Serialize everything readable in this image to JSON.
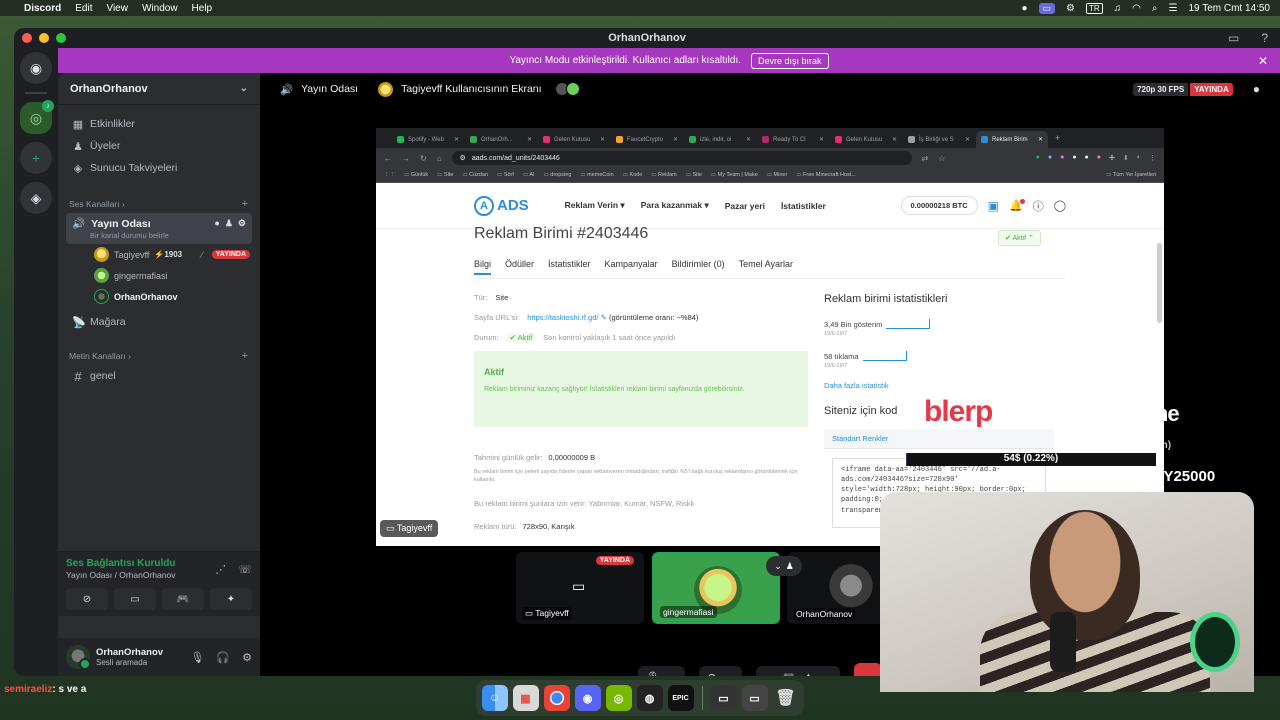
{
  "menubar": {
    "app": "Discord",
    "items": [
      "Edit",
      "View",
      "Window",
      "Help"
    ],
    "keyboard": "TR",
    "datetime": "19 Tem Cmt  14:50"
  },
  "window": {
    "title": "OrhanOrhanov"
  },
  "banner": {
    "text": "Yayıncı Modu etkinleştirildi. Kullanıcı adları kısaltıldı.",
    "button": "Devre dışı bırak"
  },
  "sidebar": {
    "server_name": "OrhanOrhanov",
    "nav": [
      {
        "icon": "calendar-icon",
        "label": "Etkinlikler"
      },
      {
        "icon": "members-icon",
        "label": "Üyeler"
      },
      {
        "icon": "boost-icon",
        "label": "Sunucu Takviyeleri"
      }
    ],
    "voice_category": "Ses Kanalları",
    "voice_channel": {
      "name": "Yayın Odası",
      "status": "Bir kanal durumu belirle"
    },
    "voice_users": [
      {
        "name": "Tagiyevff",
        "boost": "1903",
        "live": "YAYINDA"
      },
      {
        "name": "gingermafiasi"
      },
      {
        "name": "OrhanOrhanov"
      }
    ],
    "stage_channel": "Mağara",
    "text_category": "Metin Kanalları",
    "text_channel": "genel"
  },
  "voice_panel": {
    "title": "Ses Bağlantısı Kuruldu",
    "subtitle": "Yayın Odası / OrhanOrhanov"
  },
  "user_panel": {
    "name": "OrhanOrhanov",
    "status": "Sesli aramada"
  },
  "stage": {
    "channel": "Yayın Odası",
    "screen_title": "Tagiyevff Kullanıcısının Ekranı",
    "quality": "720p 30 FPS",
    "live": "YAYINDA",
    "owner_label": "Tagiyevff"
  },
  "browser": {
    "tabs": [
      "Spotify - Web",
      "OrhanOrh...",
      "Gelen Kutusu",
      "FaucetCrypto",
      "izle, indir, oi",
      "Ready To Cl",
      "Gelen Kutusu",
      "İş Birliği ve S",
      "Reklam Birim"
    ],
    "url": "aads.com/ad_units/2403446",
    "bookmarks": [
      "Günlük",
      "Site",
      "Cüzdan",
      "Sörf",
      "AI",
      "dropsieg",
      "memeCoin",
      "Kode",
      "Reklam",
      "Site",
      "My Team | Make",
      "Miner",
      "Free Minecraft Host..."
    ],
    "bookmarks_right": "Tüm Yer İşaretleri"
  },
  "ads_page": {
    "logo": "ADS",
    "nav": [
      "Reklam Verin ▾",
      "Para kazanmak ▾",
      "Pazar yeri",
      "İstatistikler"
    ],
    "balance": "0.00000218  BTC",
    "title": "Reklam Birimi #2403446",
    "status_badge": "Aktif",
    "tabs": [
      "Bilgi",
      "Ödüller",
      "İstatistikler",
      "Kampanyalar",
      "Bildirimler (0)",
      "Temel Ayarlar"
    ],
    "type_label": "Tür:",
    "type_value": "Site",
    "url_label": "Sayfa URL'si:",
    "url_value": "https://tasktoshi.rf.gd/",
    "url_note": "(görüntüleme oranı: ~%84)",
    "state_label": "Durum:",
    "state_value": "Aktif",
    "state_note": "Son kontrol yaklaşık 1 saat önce yapıldı",
    "box_title": "Aktif",
    "box_text": "Reklam biriminiz kazanç sağlıyor! İstatistikleri reklam birimi sayfanızda görebilirsiniz.",
    "earn_label": "Tahmini günlük gelir:",
    "earn_value": "0,00000009 B",
    "earn_note": "Bu reklam birimi için yeterli sayıda ödeme yapan reklamveren olmadığından, trafiğin %5'i bağlı kuruluş reklamlarını görüntülemek için kullanılır.",
    "allowed": "Bu reklam birimi şunlara izin verir: Yabrımlar, Kumar, NSFW, Riskli",
    "adtype_label": "Reklam türü:",
    "adtype_value": "728x90, Karışık",
    "stats_title": "Reklam birimi istatistikleri",
    "impressions": "3,49 Bin gösterim",
    "impressions_range": "19/6-19/7",
    "clicks": "58 tıklama",
    "clicks_range": "19/6-19/7",
    "more_stats": "Daha fazla istatistik",
    "code_title": "Siteniz için kod",
    "code_tab": "Standart Renkler",
    "code": "<iframe data-aa='2403446' src='//ad.a-ads.com/2403446?size=728x90' style='width:728px; height:90px; border:0px; padding:0; overflow:hidden; background-color: transparent;'></iframe>"
  },
  "tiles": [
    {
      "name": "Tagiyevff",
      "live": "YAYINDA"
    },
    {
      "name": "gingermafiasi"
    },
    {
      "name": "OrhanOrhanov"
    }
  ],
  "overlay": {
    "sponsor1": "blerp",
    "sponsor2": "ByNoGame",
    "faint": "den)",
    "bar": "54$ (0.22%)",
    "bar_fraction": 0.22,
    "goal": "TRY25000",
    "chat_user": "semiraeliz",
    "chat_msg": ": s ve a"
  },
  "colors": {
    "discord_bg": "#1e1f22",
    "live_red": "#da373c",
    "banner": "#a638c0",
    "online": "#23a55a",
    "ads_blue": "#2a8fd8"
  }
}
